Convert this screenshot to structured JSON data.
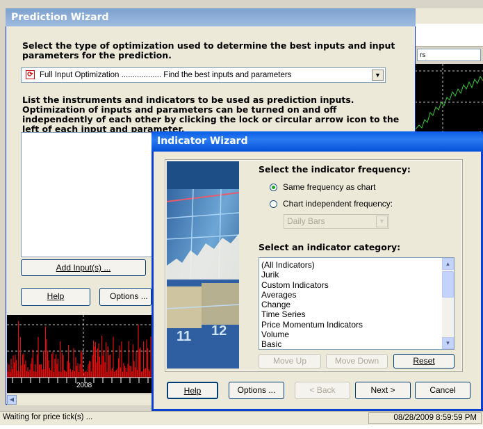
{
  "background_app": {
    "field_text": "rs"
  },
  "prediction_wizard": {
    "title": "Prediction Wizard",
    "question1": "Select the type of optimization used to determine the best inputs and input parameters for the prediction.",
    "optimization_select": {
      "selected": "Full Input Optimization .................. Find the best inputs and parameters"
    },
    "question2": "List the instruments and indicators to be used as prediction inputs.  Optimization of inputs and parameters can be turned on and off independently of each other by clicking the lock or circular arrow icon to the left of each input and parameter.",
    "add_input_label": "Add Input(s) ...",
    "help_label": "Help",
    "options_label": "Options ...",
    "chart_year_label": "2008"
  },
  "status_bar": {
    "left_text": "Waiting for price tick(s) ...",
    "right_text": "08/28/2009 8:59:59 PM"
  },
  "indicator_wizard": {
    "title": "Indicator Wizard",
    "frequency_heading": "Select the indicator frequency:",
    "radio_same": "Same frequency as chart",
    "radio_independent": "Chart independent frequency:",
    "radio_selected": "same",
    "frequency_select_value": "Daily Bars",
    "category_heading": "Select an indicator category:",
    "categories": [
      "(All Indicators)",
      "Jurik",
      "Custom Indicators",
      "Averages",
      "Change",
      "Time Series",
      "Price Momentum Indicators",
      "Volume",
      "Basic"
    ],
    "move_up_label": "Move Up",
    "move_down_label": "Move Down",
    "reset_label": "Reset",
    "help_label": "Help",
    "options_label": "Options ...",
    "back_label": "< Back",
    "next_label": "Next >",
    "cancel_label": "Cancel",
    "image_numbers": [
      "11",
      "12"
    ]
  },
  "colors": {
    "xp_title_blue": "#0a5ee6",
    "inactive_title": "#7da2ce",
    "chart_red": "#e01010",
    "chart_green": "#3cc83c"
  }
}
